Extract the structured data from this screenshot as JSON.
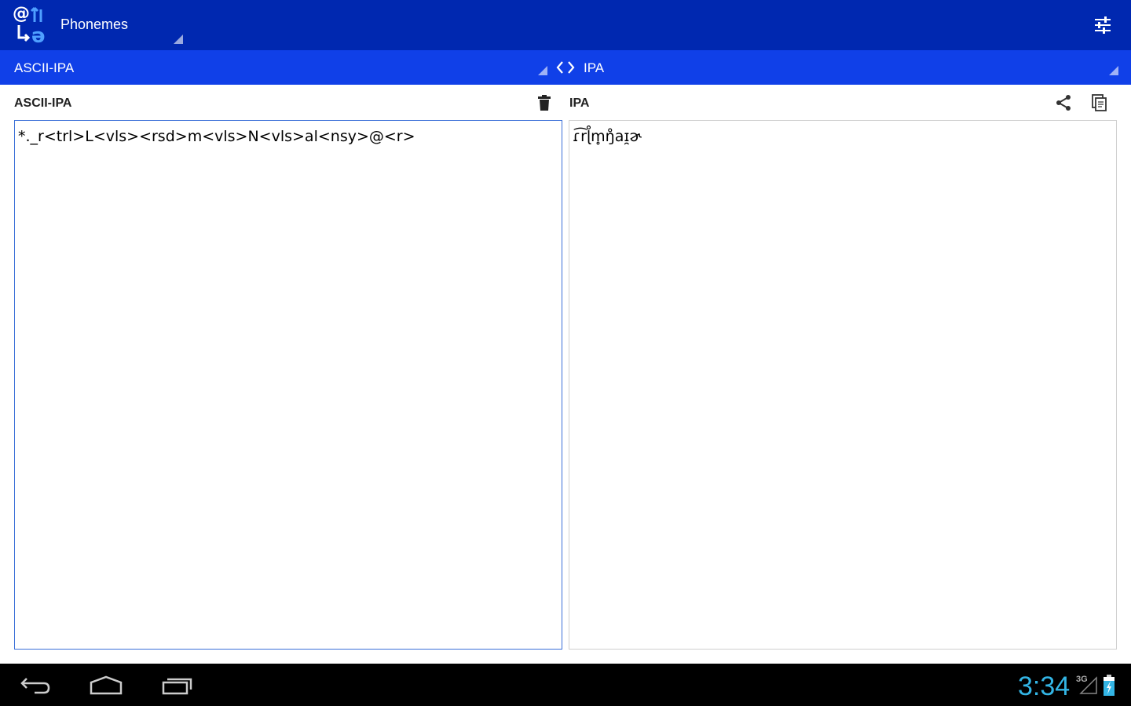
{
  "app": {
    "title": "Phonemes",
    "icon": "app-logo-icon"
  },
  "actionbar": {
    "settings_icon": "sliders-icon"
  },
  "subbar": {
    "from_encoding": "ASCII-IPA",
    "to_encoding": "IPA",
    "swap_icon": "swap-chevrons-icon"
  },
  "left_pane": {
    "label": "ASCII-IPA",
    "input_value": "*._r<trl>L<vls><rsd>m<vls>N<vls>al<nsy>@<r>",
    "delete_icon": "trash-icon"
  },
  "right_pane": {
    "label": "IPA",
    "output_value": "ɾ͡rɭ̊m̥ŋ̊aɪ̯ɚ",
    "share_icon": "share-icon",
    "copy_icon": "copy-icon"
  },
  "statusbar": {
    "time": "3:34",
    "network": "3G"
  },
  "colors": {
    "actionbar": "#0028b0",
    "subbar": "#1040e8",
    "clock": "#33b5e5",
    "input_border": "#3a6fd8"
  }
}
